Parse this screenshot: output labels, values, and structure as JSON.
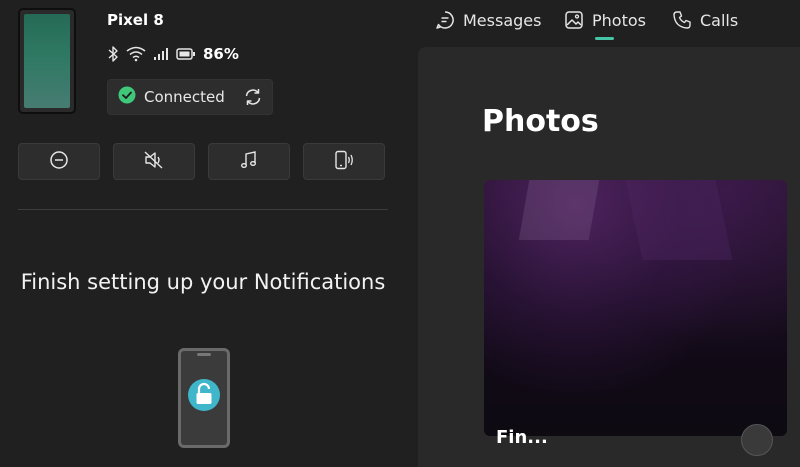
{
  "device": {
    "name": "Pixel 8",
    "battery_percent": "86%",
    "connection_status": "Connected",
    "status_icons": [
      "bluetooth-icon",
      "wifi-icon",
      "signal-icon",
      "battery-icon"
    ]
  },
  "quick_actions": [
    {
      "icon": "do-not-disturb-icon"
    },
    {
      "icon": "mute-icon"
    },
    {
      "icon": "music-icon"
    },
    {
      "icon": "phone-ring-icon"
    }
  ],
  "setup": {
    "title": "Finish setting up your Notifications"
  },
  "nav": {
    "tabs": [
      {
        "label": "Messages",
        "icon": "message-icon"
      },
      {
        "label": "Photos",
        "icon": "photo-icon",
        "selected": true
      },
      {
        "label": "Calls",
        "icon": "phone-icon"
      }
    ]
  },
  "photos": {
    "title": "Photos",
    "caption": "Fin..."
  },
  "colors": {
    "accent": "#47c4a5",
    "connected_green": "#3fc77a",
    "lock_teal": "#3fb6c9",
    "background": "#202020",
    "panel": "#292929"
  }
}
